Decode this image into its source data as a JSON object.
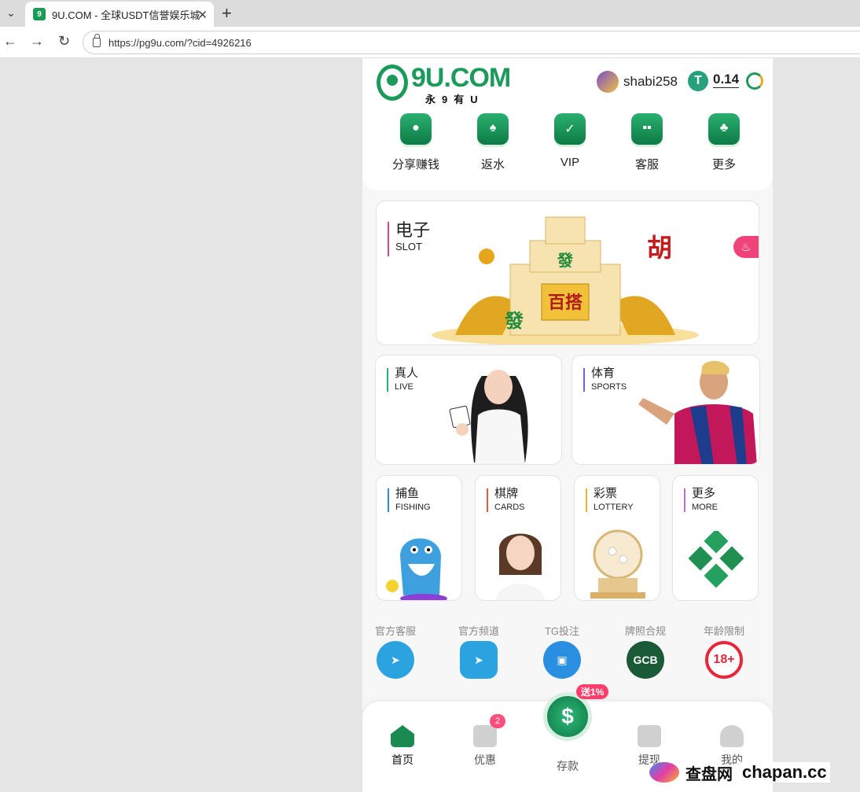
{
  "browser": {
    "tab_title": "9U.COM - 全球USDT信誉娱乐城",
    "url": "https://pg9u.com/?cid=4926216"
  },
  "header": {
    "logo_text": "9U.COM",
    "logo_sub": "永9有U",
    "username": "shabi258",
    "balance": "0.14",
    "currency_symbol": "T"
  },
  "quicknav": [
    {
      "label": "分享赚钱",
      "icon": "share-person-icon"
    },
    {
      "label": "返水",
      "icon": "rebate-icon"
    },
    {
      "label": "VIP",
      "icon": "vip-icon"
    },
    {
      "label": "客服",
      "icon": "support-icon"
    },
    {
      "label": "更多",
      "icon": "more-icon"
    }
  ],
  "games": {
    "slot": {
      "zh": "电子",
      "en": "SLOT",
      "accent": "#d9487a"
    },
    "live": {
      "zh": "真人",
      "en": "LIVE",
      "accent": "#20b37b"
    },
    "sports": {
      "zh": "体育",
      "en": "SPORTS",
      "accent": "#7b5cd6"
    },
    "fishing": {
      "zh": "捕鱼",
      "en": "FISHING",
      "accent": "#2e8bd8"
    },
    "cards": {
      "zh": "棋牌",
      "en": "CARDS",
      "accent": "#e0603a"
    },
    "lottery": {
      "zh": "彩票",
      "en": "LOTTERY",
      "accent": "#e8b62a"
    },
    "more": {
      "zh": "更多",
      "en": "MORE",
      "accent": "#c26ad6"
    }
  },
  "contacts": [
    {
      "label": "官方客服",
      "icon": "telegram-icon"
    },
    {
      "label": "官方频道",
      "icon": "telegram-channel-icon"
    },
    {
      "label": "TG投注",
      "icon": "android-bot-icon"
    },
    {
      "label": "牌照合规",
      "icon": "gcb-license-icon",
      "text": "GCB"
    },
    {
      "label": "年龄限制",
      "icon": "age-18-icon",
      "text": "18+"
    }
  ],
  "bottomnav": {
    "home": "首页",
    "promo": "优惠",
    "promo_count": "2",
    "deposit": "存款",
    "deposit_bonus": "送1%",
    "withdraw": "提现",
    "mine": "我的"
  },
  "watermark": {
    "zh": "查盘网",
    "en": "chapan.cc"
  }
}
